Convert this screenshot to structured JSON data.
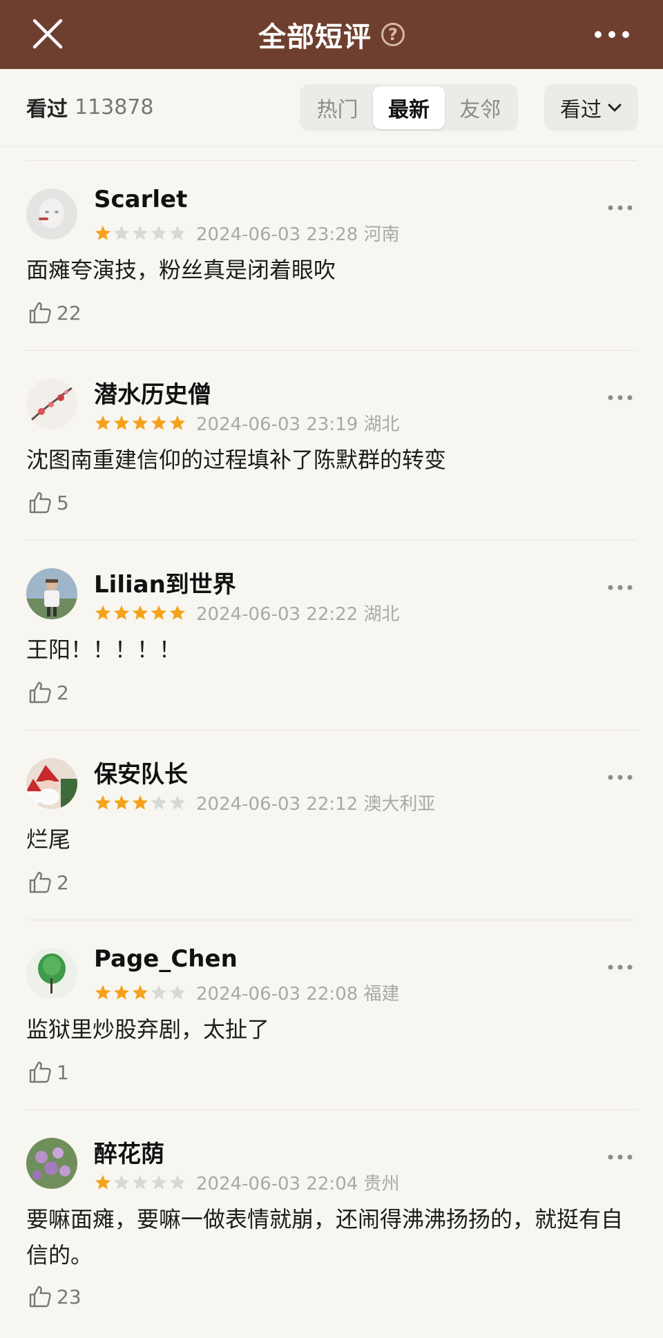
{
  "header": {
    "title": "全部短评",
    "help_icon": "question-circle-icon",
    "close_icon": "close-icon",
    "more_icon": "more-horizontal-icon"
  },
  "filter": {
    "seen_label": "看过",
    "seen_count": "113878",
    "tabs": [
      {
        "label": "热门",
        "active": false
      },
      {
        "label": "最新",
        "active": true
      },
      {
        "label": "友邻",
        "active": false
      }
    ],
    "dropdown_label": "看过"
  },
  "colors": {
    "header_bg": "#6e3f2f",
    "star_filled": "#f5a21b",
    "star_empty": "#d8d8d8",
    "page_bg": "#f8f6f1"
  },
  "comments": [
    {
      "user": "Scarlet",
      "rating": 1,
      "date": "2024-06-03 23:28 河南",
      "text": "面瘫夸演技，粉丝真是闭着眼吹",
      "likes": "22"
    },
    {
      "user": "潜水历史僧",
      "rating": 5,
      "date": "2024-06-03 23:19 湖北",
      "text": "沈图南重建信仰的过程填补了陈默群的转变",
      "likes": "5"
    },
    {
      "user": "Lilian到世界",
      "rating": 5,
      "date": "2024-06-03 22:22 湖北",
      "text": "王阳！！！！！",
      "likes": "2"
    },
    {
      "user": "保安队长",
      "rating": 3,
      "date": "2024-06-03 22:12 澳大利亚",
      "text": "烂尾",
      "likes": "2"
    },
    {
      "user": "Page_Chen",
      "rating": 3,
      "date": "2024-06-03 22:08 福建",
      "text": "监狱里炒股弃剧，太扯了",
      "likes": "1"
    },
    {
      "user": "醉花荫",
      "rating": 1,
      "date": "2024-06-03 22:04 贵州",
      "text": "要嘛面瘫，要嘛一做表情就崩，还闹得沸沸扬扬的，就挺有自信的。",
      "likes": "23"
    }
  ]
}
